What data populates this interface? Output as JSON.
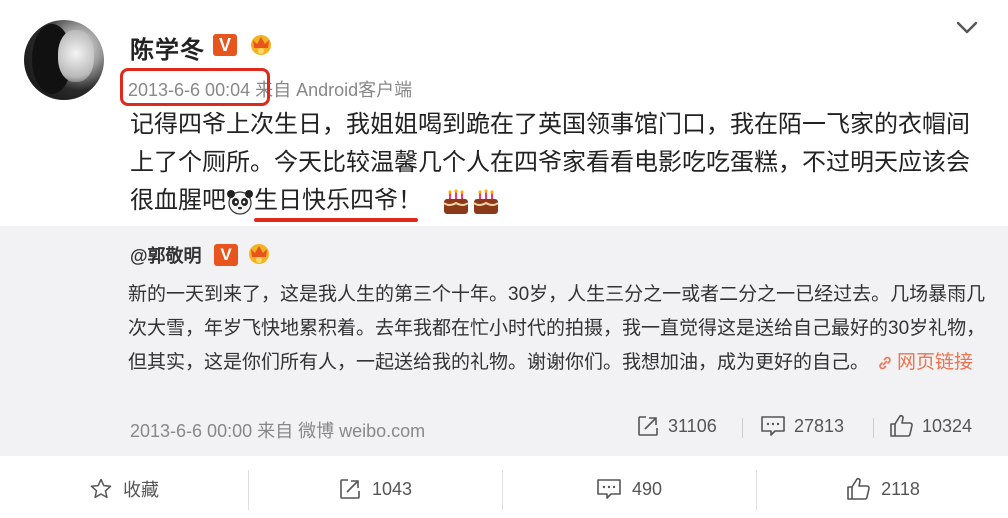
{
  "post": {
    "username": "陈学冬",
    "v_badge": "V",
    "timestamp": "2013-6-6 00:04",
    "source": "来自 Android客户端",
    "content_line1": "记得四爷上次生日，我姐姐喝到跪在了英国领事馆门口，我在陌一飞家的衣帽间",
    "content_line2": "上了个厕所。今天比较温馨几个人在四爷家看看电影吃吃蛋糕，不过明天应该会",
    "content_line3_a": "很血腥吧",
    "content_line3_b": "生日快乐四爷！",
    "icons": {
      "avatar": "avatar",
      "chevron": "chevron-down-icon",
      "crown": "crown-badge-icon",
      "panda": "panda-emoji",
      "cake": "cake-emoji"
    },
    "accent_color": "#e0291b"
  },
  "repost": {
    "username": "@郭敬明",
    "v_badge": "V",
    "text": "新的一天到来了，这是我人生的第三个十年。30岁，人生三分之一或者二分之一已经过去。几场暴雨几次大雪，年岁飞快地累积着。去年我都在忙小时代的拍摄，我一直觉得这是送给自己最好的30岁礼物，但其实，这是你们所有人，一起送给我的礼物。谢谢你们。我想加油，成为更好的自己。",
    "link_label": "网页链接",
    "timestamp_source": "2013-6-6 00:00 来自 微博 weibo.com",
    "reposts": "31106",
    "comments": "27813",
    "likes": "10324",
    "link_color": "#eb7350"
  },
  "actions": {
    "favorite": "收藏",
    "repost": "1043",
    "comment": "490",
    "like": "2118"
  }
}
